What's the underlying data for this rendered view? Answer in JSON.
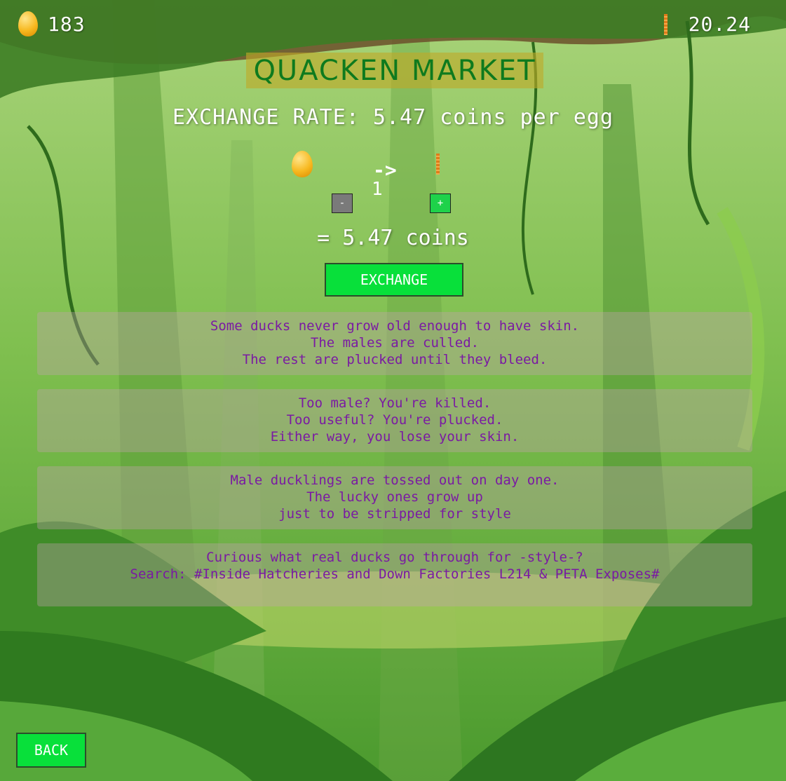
{
  "hud": {
    "eggs_icon": "golden-egg",
    "eggs_count": "183",
    "coins_icon": "coin-bar",
    "coins_value": "20.24"
  },
  "market": {
    "title": "QUACKEN MARKET",
    "rate_text": "EXCHANGE RATE: 5.47 coins per egg",
    "arrow": "->",
    "quantity": "1",
    "minus_label": "-",
    "plus_label": "+",
    "result_text": "= 5.47 coins",
    "exchange_label": "EXCHANGE"
  },
  "messages": [
    {
      "lines": [
        "Some ducks never grow old enough to have skin.",
        "The males are culled.",
        "The rest are plucked until they bleed."
      ]
    },
    {
      "lines": [
        "Too male? You're killed.",
        "Too useful? You're plucked.",
        "Either way, you lose your skin."
      ]
    },
    {
      "lines": [
        "Male ducklings are tossed out on day one.",
        "The lucky ones grow up",
        "just to be stripped for style"
      ]
    },
    {
      "lines": [
        "Curious what real ducks go through for -style-?",
        "Search: #Inside Hatcheries and Down Factories  L214 & PETA Exposes#"
      ]
    }
  ],
  "nav": {
    "back_label": "BACK"
  },
  "colors": {
    "button_green": "#08e03a",
    "title_green": "#0e7a1e",
    "message_purple": "#7a1aa3",
    "title_box": "#bea a28"
  }
}
